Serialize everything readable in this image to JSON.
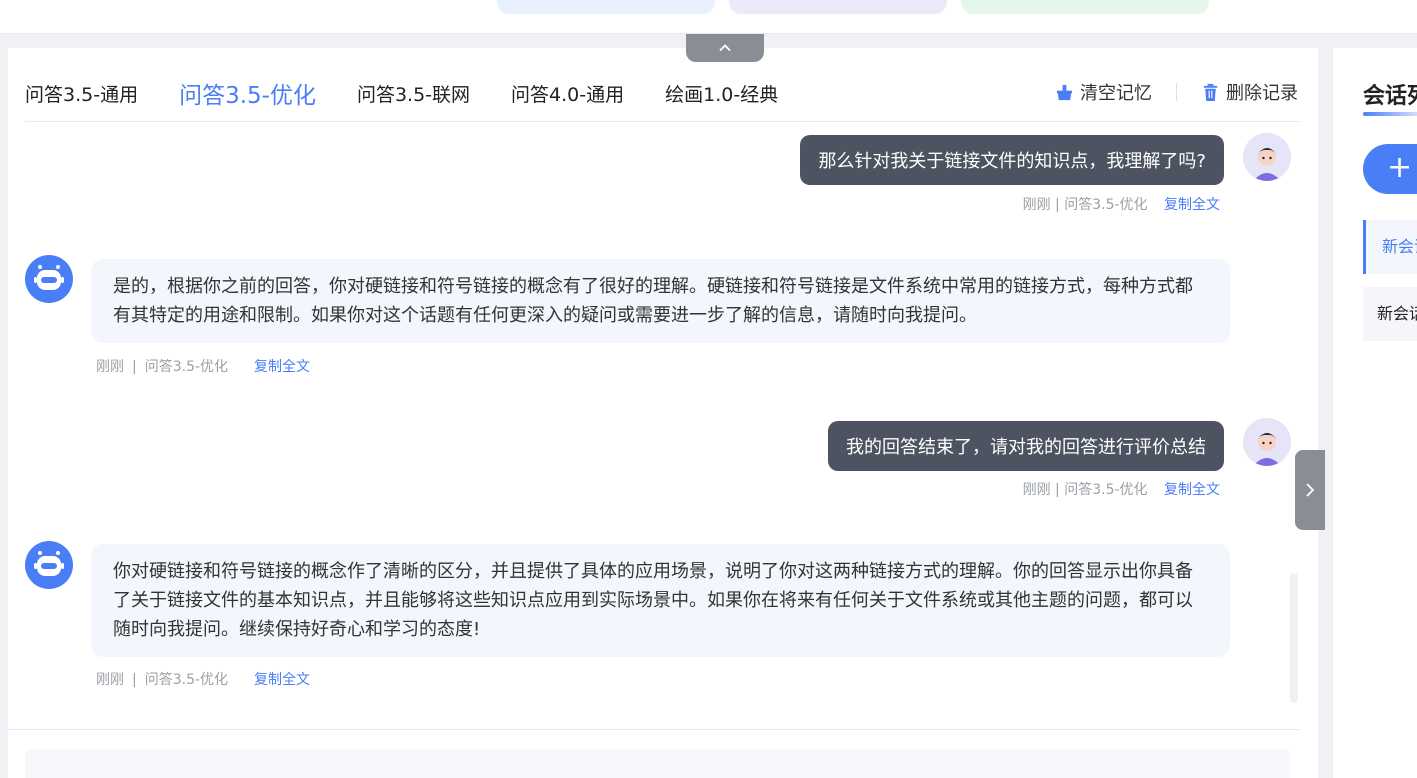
{
  "tabs": [
    {
      "label": "问答3.5-通用"
    },
    {
      "label": "问答3.5-优化"
    },
    {
      "label": "问答3.5-联网"
    },
    {
      "label": "问答4.0-通用"
    },
    {
      "label": "绘画1.0-经典"
    }
  ],
  "active_tab_index": 1,
  "toolbar": {
    "clear_memory": "清空记忆",
    "delete_records": "删除记录"
  },
  "messages": [
    {
      "role": "user",
      "text": "那么针对我关于链接文件的知识点，我理解了吗?",
      "time": "刚刚",
      "model": "问答3.5-优化",
      "copy": "复制全文"
    },
    {
      "role": "bot",
      "text": "是的，根据你之前的回答，你对硬链接和符号链接的概念有了很好的理解。硬链接和符号链接是文件系统中常用的链接方式，每种方式都有其特定的用途和限制。如果你对这个话题有任何更深入的疑问或需要进一步了解的信息，请随时向我提问。",
      "time": "刚刚",
      "model": "问答3.5-优化",
      "copy": "复制全文"
    },
    {
      "role": "user",
      "text": "我的回答结束了，请对我的回答进行评价总结",
      "time": "刚刚",
      "model": "问答3.5-优化",
      "copy": "复制全文"
    },
    {
      "role": "bot",
      "text": "你对硬链接和符号链接的概念作了清晰的区分，并且提供了具体的应用场景，说明了你对这两种链接方式的理解。你的回答显示出你具备了关于链接文件的基本知识点，并且能够将这些知识点应用到实际场景中。如果你在将来有任何关于文件系统或其他主题的问题，都可以随时向我提问。继续保持好奇心和学习的态度!",
      "time": "刚刚",
      "model": "问答3.5-优化",
      "copy": "复制全文"
    }
  ],
  "meta_sep": "|",
  "right_panel": {
    "title": "会话列",
    "new_button": "+",
    "sessions": [
      {
        "label": "新会话"
      },
      {
        "label": "新会话"
      }
    ]
  },
  "colors": {
    "accent": "#4a7ef6",
    "user_bubble": "#4d5361",
    "bot_bubble": "#f3f6fd"
  }
}
